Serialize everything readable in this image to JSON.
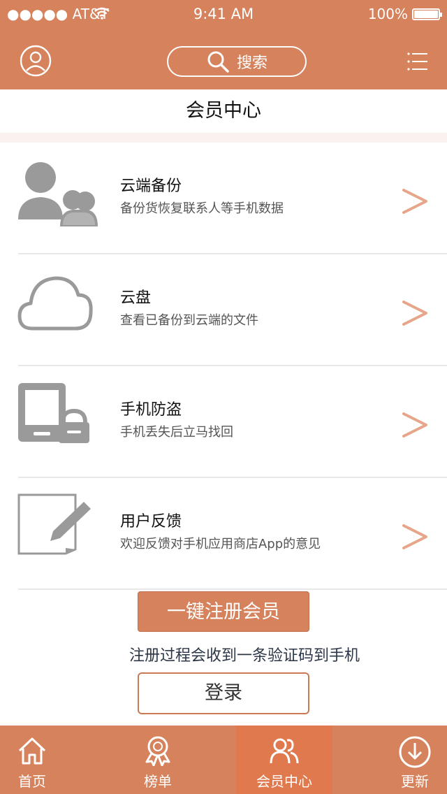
{
  "status_bar": {
    "carrier": "●●●●● AT&T",
    "time": "9:41 AM",
    "battery": "100%"
  },
  "header": {
    "search_label": "搜索"
  },
  "page": {
    "title": "会员中心"
  },
  "menu": [
    {
      "title": "云端备份",
      "desc": "备份货恢复联系人等手机数据",
      "icon": "contacts-backup-icon"
    },
    {
      "title": "云盘",
      "desc": "查看已备份到云端的文件",
      "icon": "cloud-icon"
    },
    {
      "title": "手机防盗",
      "desc": "手机丢失后立马找回",
      "icon": "phone-lock-icon"
    },
    {
      "title": "用户反馈",
      "desc": "欢迎反馈对手机应用商店App的意见",
      "icon": "edit-note-icon"
    }
  ],
  "actions": {
    "register_label": "一键注册会员",
    "register_hint": "注册过程会收到一条验证码到手机",
    "login_label": "登录"
  },
  "tab_bar": {
    "tabs": [
      {
        "label": "首页",
        "icon": "home-icon"
      },
      {
        "label": "榜单",
        "icon": "ranking-badge-icon"
      },
      {
        "label": "会员中心",
        "icon": "members-icon",
        "active": true
      },
      {
        "label": "更新",
        "icon": "download-icon"
      }
    ]
  },
  "colors": {
    "brand": "#d6825c",
    "active_tab": "#e07a4e",
    "chevron": "#e8a689",
    "icon_gray": "#9a9a9a"
  }
}
